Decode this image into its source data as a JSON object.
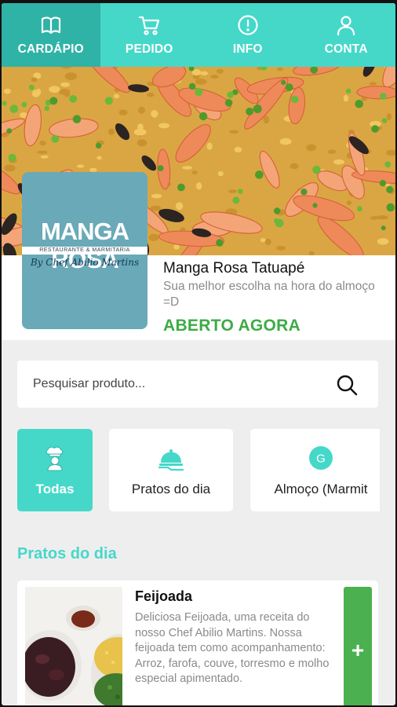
{
  "nav": {
    "tabs": [
      {
        "label": "CARDÁPIO",
        "icon": "book-icon",
        "active": true
      },
      {
        "label": "PEDIDO",
        "icon": "cart-icon",
        "active": false
      },
      {
        "label": "INFO",
        "icon": "info-icon",
        "active": false
      },
      {
        "label": "CONTA",
        "icon": "user-icon",
        "active": false
      }
    ]
  },
  "restaurant": {
    "logo_title": "MANGA ROSA",
    "logo_subtitle": "RESTAURANTE & MARMITARIA",
    "logo_chef": "By Chef Abilio Martins",
    "name": "Manga Rosa Tatuapé",
    "description": "Sua melhor escolha na hora do almoço =D",
    "status": "ABERTO AGORA"
  },
  "search": {
    "placeholder": "Pesquisar produto...",
    "icon": "search-icon"
  },
  "categories": [
    {
      "label": "Todas",
      "icon": "chef-icon",
      "active": true
    },
    {
      "label": "Pratos do dia",
      "icon": "serving-dish-icon",
      "active": false
    },
    {
      "label": "Almoço (Marmit",
      "icon": "g-badge-icon",
      "active": false
    }
  ],
  "section_title": "Pratos do dia",
  "product": {
    "name": "Feijoada",
    "description": "Deliciosa Feijoada, uma receita do nosso Chef Abilio Martins. Nossa feijoada tem como acompanhamento: Arroz, farofa, couve, torresmo e molho especial apimentado.",
    "add_label": "+"
  },
  "colors": {
    "accent": "#45d8c9",
    "accent_dark": "#2fb3a6",
    "open": "#3dab46",
    "add_button": "#4bb050"
  }
}
